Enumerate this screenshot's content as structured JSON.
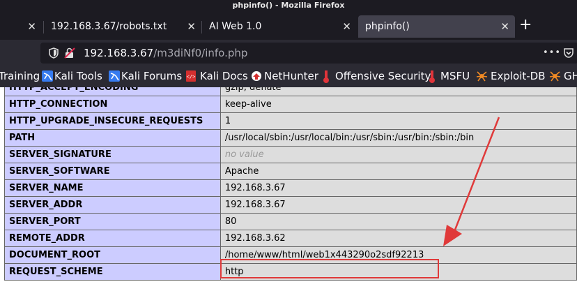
{
  "window": {
    "title": "phpinfo() - Mozilla Firefox"
  },
  "tabs": [
    {
      "label": "",
      "active": false
    },
    {
      "label": "192.168.3.67/robots.txt",
      "active": false
    },
    {
      "label": "AI Web 1.0",
      "active": false
    },
    {
      "label": "phpinfo()",
      "active": true
    }
  ],
  "address": {
    "host": "192.168.3.67",
    "path": "/m3diNf0/info.php"
  },
  "bookmarks": [
    {
      "label": "Training",
      "icon": "none"
    },
    {
      "label": "Kali Tools",
      "icon": "kali-dragon-icon"
    },
    {
      "label": "Kali Forums",
      "icon": "kali-dragon-icon"
    },
    {
      "label": "Kali Docs",
      "icon": "kali-docs-icon"
    },
    {
      "label": "NetHunter",
      "icon": "nethunter-icon"
    },
    {
      "label": "Offensive Security",
      "icon": "offsec-icon"
    },
    {
      "label": "MSFU",
      "icon": "offsec-icon"
    },
    {
      "label": "Exploit-DB",
      "icon": "exploitdb-icon"
    },
    {
      "label": "GH",
      "icon": "exploitdb-icon"
    }
  ],
  "env_rows": [
    {
      "key": "HTTP_ACCEPT_ENCODING",
      "value": "gzip, deflate"
    },
    {
      "key": "HTTP_CONNECTION",
      "value": "keep-alive"
    },
    {
      "key": "HTTP_UPGRADE_INSECURE_REQUESTS",
      "value": "1"
    },
    {
      "key": "PATH",
      "value": "/usr/local/sbin:/usr/local/bin:/usr/sbin:/usr/bin:/sbin:/bin"
    },
    {
      "key": "SERVER_SIGNATURE",
      "value": "no value"
    },
    {
      "key": "SERVER_SOFTWARE",
      "value": "Apache"
    },
    {
      "key": "SERVER_NAME",
      "value": "192.168.3.67"
    },
    {
      "key": "SERVER_ADDR",
      "value": "192.168.3.67"
    },
    {
      "key": "SERVER_PORT",
      "value": "80"
    },
    {
      "key": "REMOTE_ADDR",
      "value": "192.168.3.62"
    },
    {
      "key": "DOCUMENT_ROOT",
      "value": "/home/www/html/web1x443290o2sdf92213"
    },
    {
      "key": "REQUEST_SCHEME",
      "value": "http"
    }
  ],
  "colors": {
    "key_cell": "#ccccff",
    "value_cell": "#dddddd",
    "annotation_red": "#e03a3a",
    "chrome_dark": "#1c1b22",
    "chrome": "#2b2a33"
  }
}
